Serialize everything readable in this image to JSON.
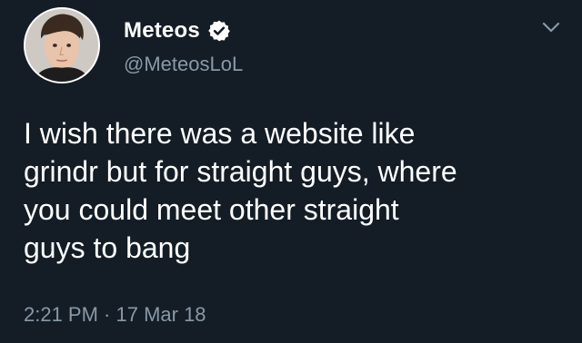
{
  "author": {
    "display_name": "Meteos",
    "handle": "@MeteosLoL",
    "verified_icon": "verified-badge-icon"
  },
  "tweet": {
    "text": "I wish there was a website like\ngrindr but for straight guys, where\nyou could meet other straight\nguys to bang",
    "timestamp": "2:21 PM · 17 Mar 18"
  },
  "colors": {
    "background": "#141d26",
    "text": "#ffffff",
    "secondary_text": "#8899a6"
  },
  "icons": {
    "menu": "chevron-down-icon",
    "avatar": "avatar"
  }
}
